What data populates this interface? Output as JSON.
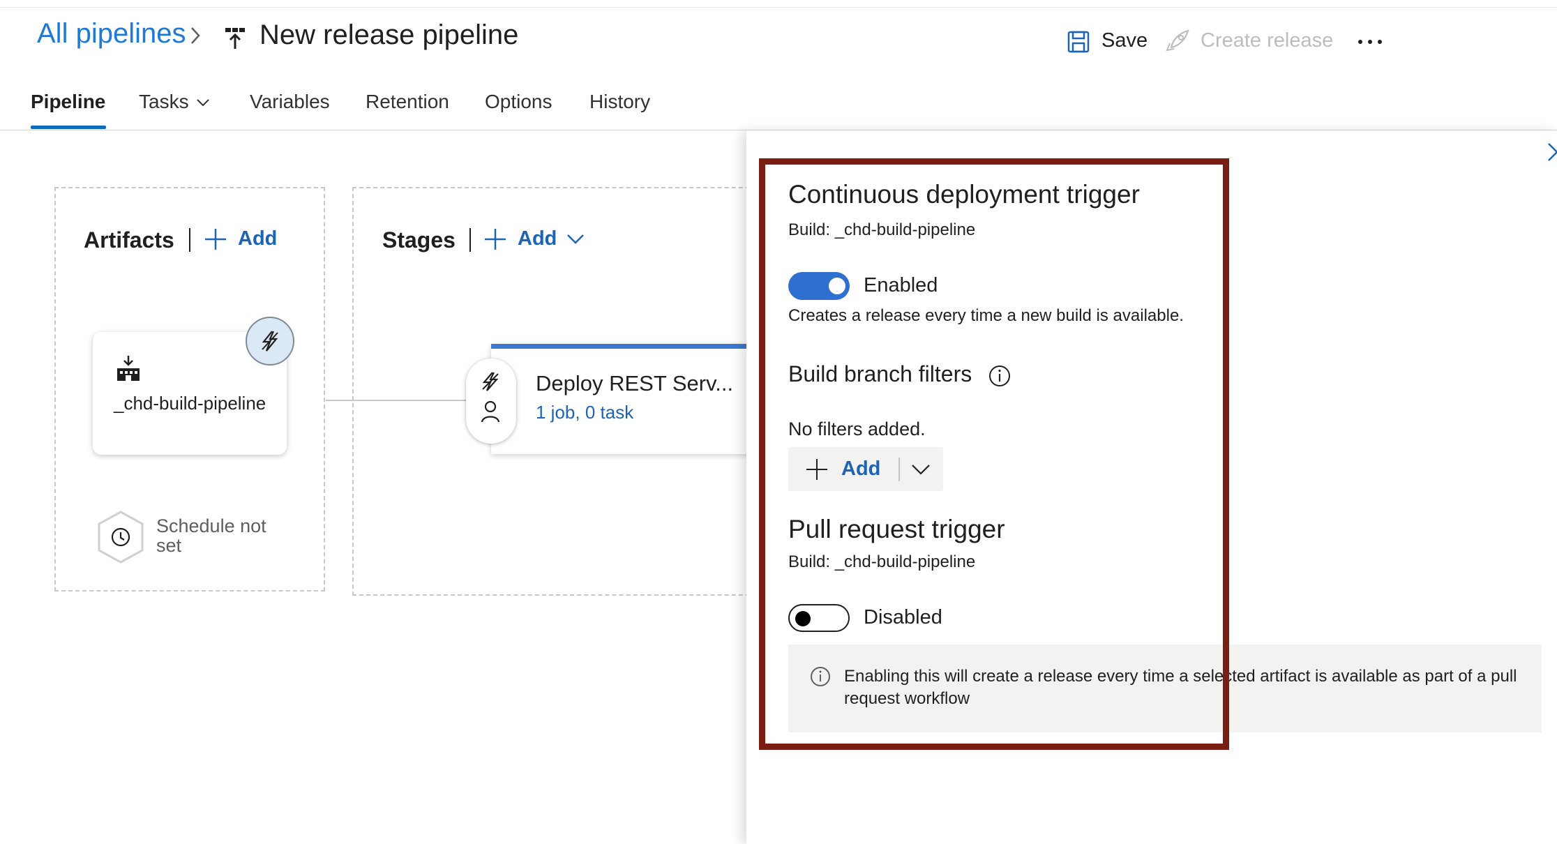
{
  "header": {
    "breadcrumb": "All pipelines",
    "title": "New release pipeline",
    "save_label": "Save",
    "create_release_label": "Create release"
  },
  "tabs": [
    {
      "label": "Pipeline",
      "active": true
    },
    {
      "label": "Tasks",
      "active": false
    },
    {
      "label": "Variables",
      "active": false
    },
    {
      "label": "Retention",
      "active": false
    },
    {
      "label": "Options",
      "active": false
    },
    {
      "label": "History",
      "active": false
    }
  ],
  "artifacts": {
    "title": "Artifacts",
    "add_label": "Add",
    "artifact_name": "_chd-build-pipeline",
    "schedule_label": "Schedule not set"
  },
  "stages": {
    "title": "Stages",
    "add_label": "Add",
    "stage_name": "Deploy REST Serv...",
    "stage_summary": "1 job, 0 task"
  },
  "panel": {
    "cd_trigger": {
      "title": "Continuous deployment trigger",
      "build_source": "Build: _chd-build-pipeline",
      "toggle_label": "Enabled",
      "toggle_on": true,
      "description": "Creates a release every time a new build is available."
    },
    "branch_filters": {
      "title": "Build branch filters",
      "empty_text": "No filters added.",
      "add_label": "Add"
    },
    "pr_trigger": {
      "title": "Pull request trigger",
      "build_source": "Build: _chd-build-pipeline",
      "toggle_label": "Disabled",
      "toggle_on": false,
      "info_text": "Enabling this will create a release every time a selected artifact is available as part of a pull request workflow"
    }
  },
  "colors": {
    "accent": "#2f6fd0",
    "link": "#1e64b4",
    "highlight_border": "#7a1d12"
  }
}
